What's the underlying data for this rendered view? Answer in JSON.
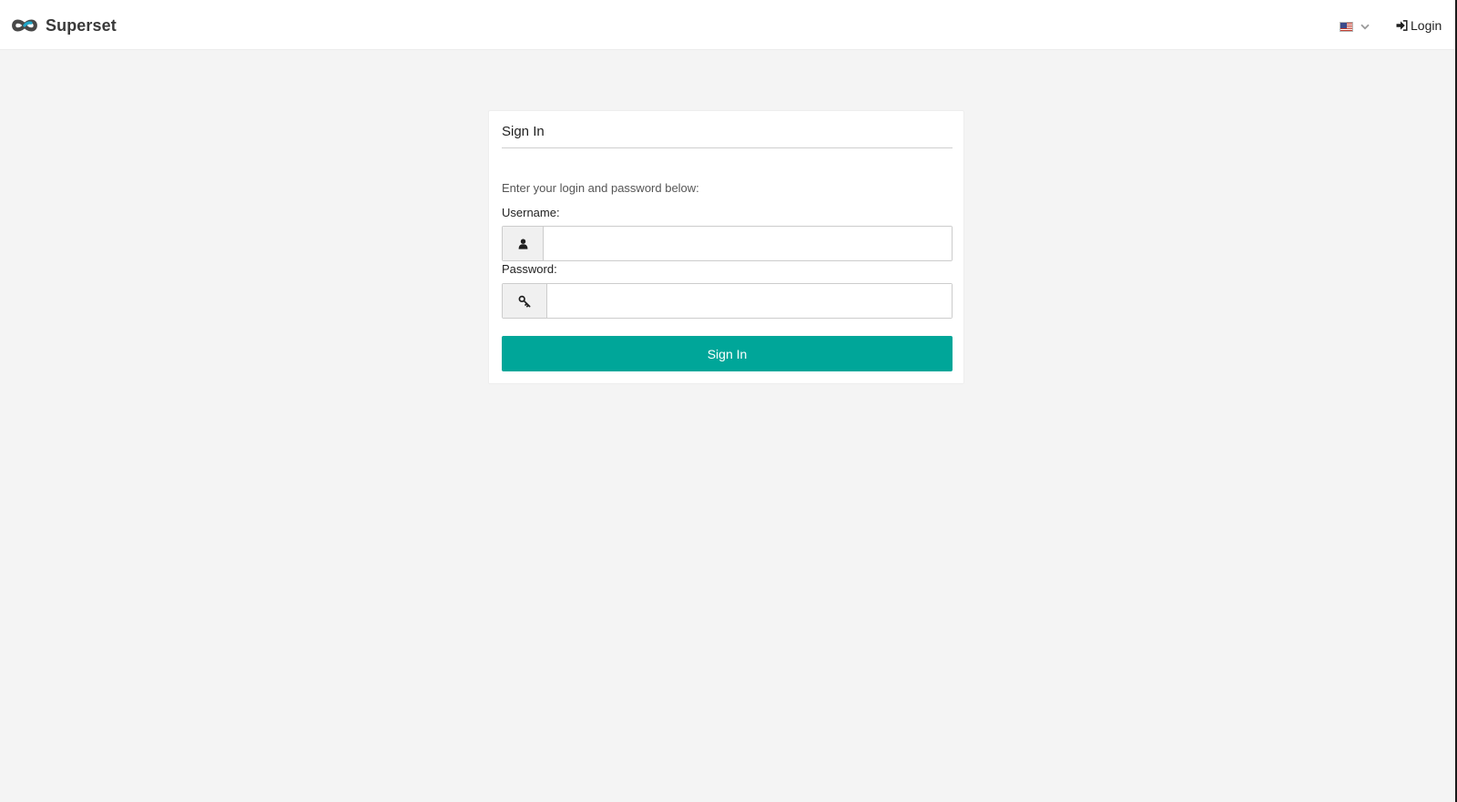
{
  "navbar": {
    "brand_name": "Superset",
    "brand_icon": "superset-logo-icon",
    "language": {
      "flag": "us-flag-icon",
      "dropdown_icon": "chevron-down-icon"
    },
    "login_label": "Login",
    "login_icon": "sign-in-icon"
  },
  "login_form": {
    "title": "Sign In",
    "instructions": "Enter your login and password below:",
    "username": {
      "label": "Username:",
      "value": "",
      "placeholder": "",
      "icon": "user-icon"
    },
    "password": {
      "label": "Password:",
      "value": "",
      "placeholder": "",
      "icon": "key-icon"
    },
    "submit_label": "Sign In"
  },
  "colors": {
    "accent": "#00a699",
    "background": "#f4f4f4",
    "card": "#ffffff"
  }
}
